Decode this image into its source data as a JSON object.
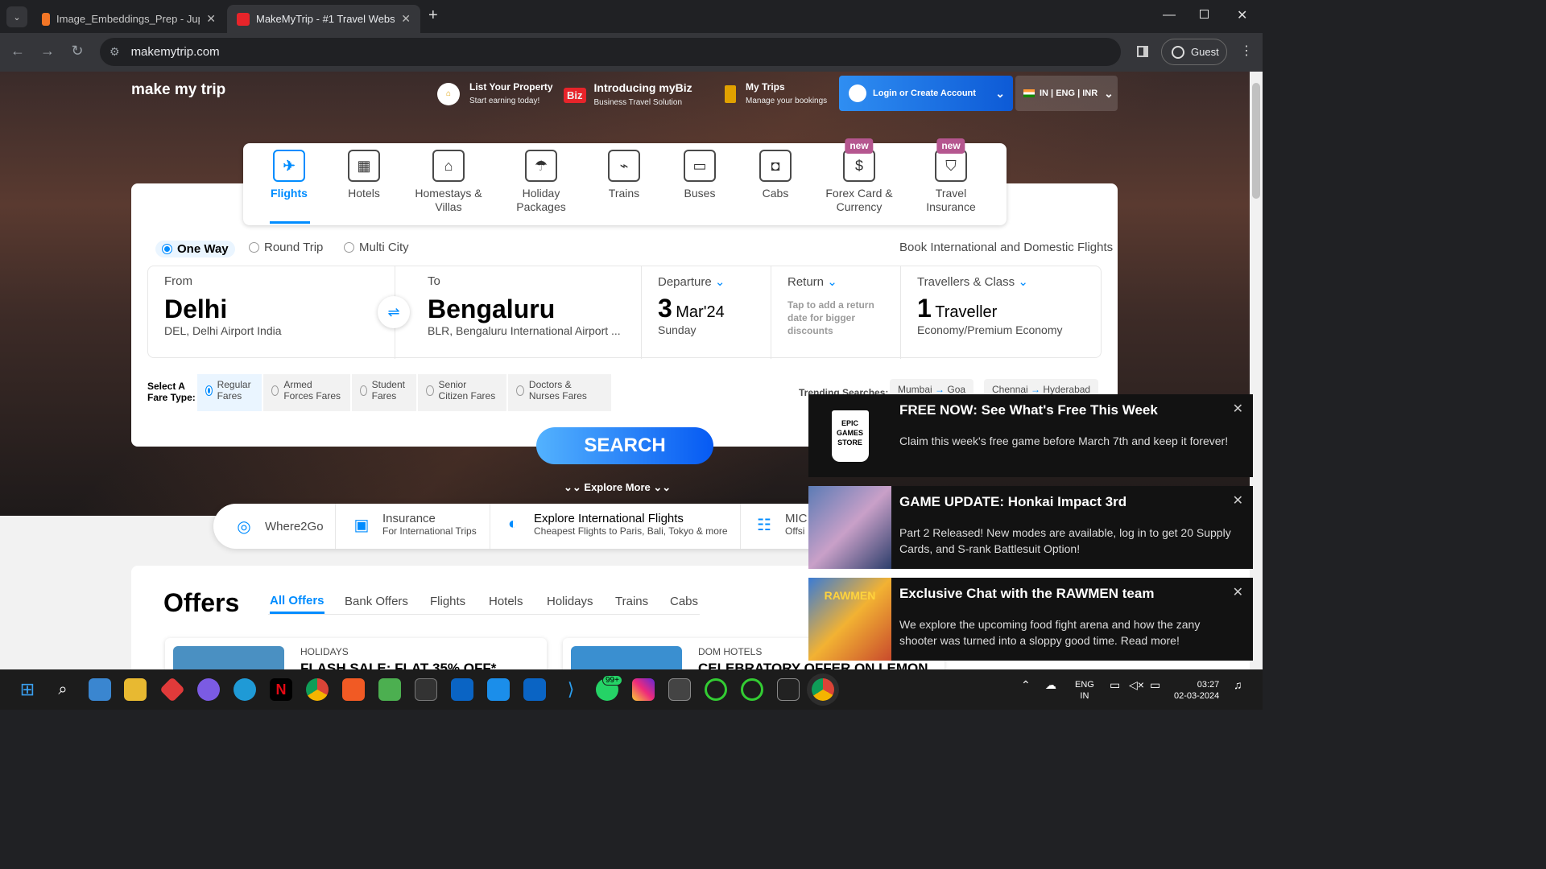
{
  "browser": {
    "tabs": [
      {
        "title": "Image_Embeddings_Prep - Jupy",
        "active": false
      },
      {
        "title": "MakeMyTrip - #1 Travel Websit",
        "active": true
      }
    ],
    "new_tab": "+",
    "url": "makemytrip.com",
    "guest_label": "Guest"
  },
  "header": {
    "logo": "make my trip",
    "list_property": {
      "title": "List Your Property",
      "sub": "Start earning today!"
    },
    "mybiz": {
      "badge": "Biz",
      "title": "Introducing myBiz",
      "sub": "Business Travel Solution"
    },
    "my_trips": {
      "title": "My Trips",
      "sub": "Manage your bookings"
    },
    "login": "Login or Create Account",
    "locale": "IN | ENG | INR"
  },
  "products": [
    {
      "label": "Flights",
      "icon": "plane-icon",
      "glyph": "✈"
    },
    {
      "label": "Hotels",
      "icon": "hotel-icon",
      "glyph": "▦"
    },
    {
      "label": "Homestays & Villas",
      "icon": "home-icon",
      "glyph": "⌂"
    },
    {
      "label": "Holiday Packages",
      "icon": "umbrella-icon",
      "glyph": "☂"
    },
    {
      "label": "Trains",
      "icon": "train-icon",
      "glyph": "⌁"
    },
    {
      "label": "Buses",
      "icon": "bus-icon",
      "glyph": "▭"
    },
    {
      "label": "Cabs",
      "icon": "cab-icon",
      "glyph": "◘"
    },
    {
      "label": "Forex Card & Currency",
      "icon": "forex-icon",
      "glyph": "$",
      "badge": "new"
    },
    {
      "label": "Travel Insurance",
      "icon": "insurance-icon",
      "glyph": "⛉",
      "badge": "new"
    }
  ],
  "trip_types": {
    "one_way": "One Way",
    "round_trip": "Round Trip",
    "multi_city": "Multi City",
    "tagline": "Book International and Domestic Flights"
  },
  "search": {
    "from": {
      "label": "From",
      "city": "Delhi",
      "airport": "DEL, Delhi Airport India"
    },
    "to": {
      "label": "To",
      "city": "Bengaluru",
      "airport": "BLR, Bengaluru International Airport ..."
    },
    "departure": {
      "label": "Departure",
      "day": "3",
      "month": "Mar'24",
      "weekday": "Sunday"
    },
    "return": {
      "label": "Return",
      "hint": "Tap to add a return date for bigger discounts"
    },
    "travellers": {
      "label": "Travellers & Class",
      "count": "1",
      "unit": "Traveller",
      "class": "Economy/Premium Economy"
    }
  },
  "fare_type": {
    "label": "Select A Fare Type:",
    "options": [
      "Regular Fares",
      "Armed Forces Fares",
      "Student Fares",
      "Senior Citizen Fares",
      "Doctors & Nurses Fares"
    ]
  },
  "trending": {
    "label": "Trending Searches:",
    "items": [
      {
        "from": "Mumbai",
        "to": "Goa"
      },
      {
        "from": "Chennai",
        "to": "Hyderabad"
      }
    ]
  },
  "search_button": "SEARCH",
  "explore_more": "Explore More",
  "strip": [
    {
      "title": "Where2Go",
      "sub": ""
    },
    {
      "title": "Insurance",
      "sub": "For International Trips"
    },
    {
      "title": "Explore International Flights",
      "sub": "Cheapest Flights to Paris, Bali, Tokyo & more"
    },
    {
      "title": "MIC",
      "sub": "Offsi"
    }
  ],
  "offers": {
    "title": "Offers",
    "tabs": [
      "All Offers",
      "Bank Offers",
      "Flights",
      "Hotels",
      "Holidays",
      "Trains",
      "Cabs"
    ],
    "cards": [
      {
        "category": "HOLIDAYS",
        "headline": "FLASH SALE: FLAT 35% OFF*"
      },
      {
        "category": "DOM HOTELS",
        "headline": "CELEBRATORY OFFER ON LEMON"
      }
    ]
  },
  "notifications": [
    {
      "title": "FREE NOW: See What's Free This Week",
      "body": "Claim this week's free game before March 7th and keep it forever!",
      "image": "EPIC GAMES STORE"
    },
    {
      "title": "GAME UPDATE: Honkai Impact 3rd",
      "body": "Part 2 Released! New modes are available, log in to get 20 Supply Cards, and S-rank Battlesuit Option!",
      "image": ""
    },
    {
      "title": "Exclusive Chat with the RAWMEN team",
      "body": "We explore the upcoming food fight arena and how the zany shooter was turned into a sloppy good time. Read more!",
      "image": "RAWMEN"
    }
  ],
  "taskbar": {
    "whatsapp_badge": "99+",
    "lang_top": "ENG",
    "lang_bottom": "IN",
    "time": "03:27",
    "date": "02-03-2024"
  }
}
